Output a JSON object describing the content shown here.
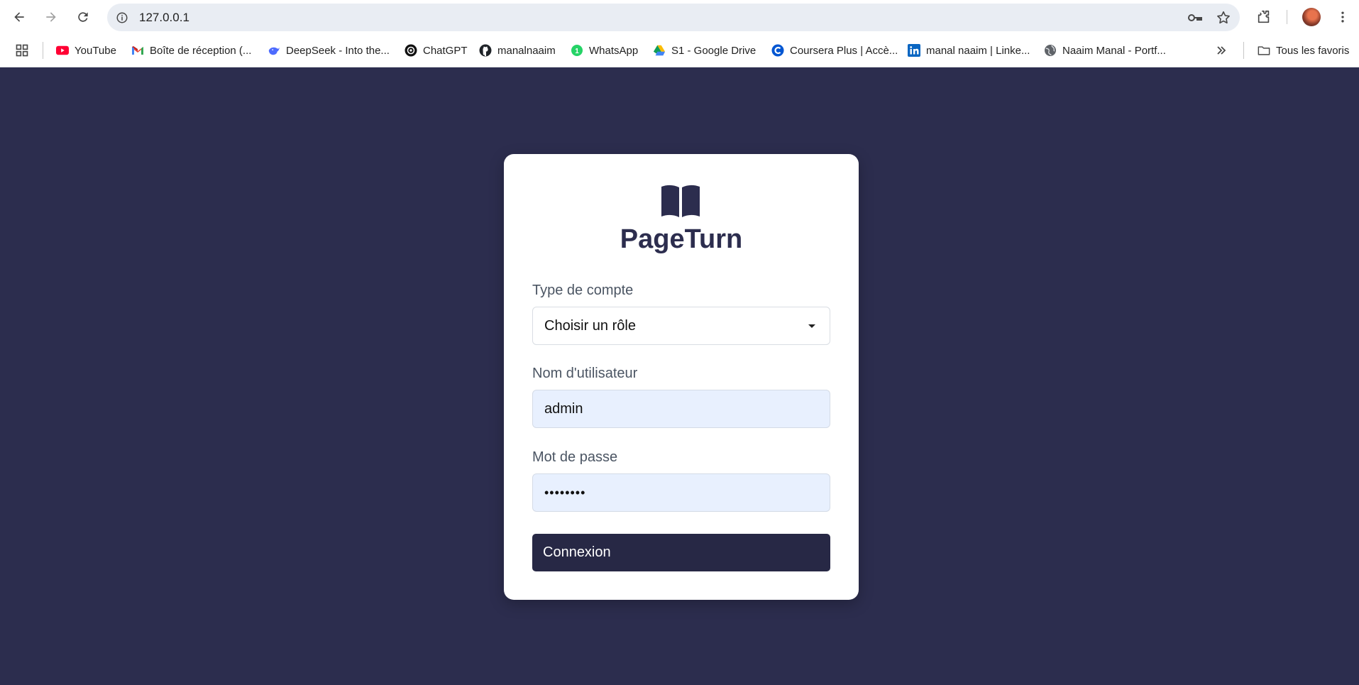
{
  "browser": {
    "url": "127.0.0.1",
    "bookmarks": [
      {
        "label": "YouTube",
        "icon": "youtube-icon"
      },
      {
        "label": "Boîte de réception (...",
        "icon": "gmail-icon"
      },
      {
        "label": "DeepSeek - Into the...",
        "icon": "deepseek-icon"
      },
      {
        "label": "ChatGPT",
        "icon": "chatgpt-icon"
      },
      {
        "label": "manalnaaim",
        "icon": "github-icon"
      },
      {
        "label": "WhatsApp",
        "icon": "whatsapp-icon"
      },
      {
        "label": "S1 - Google Drive",
        "icon": "google-drive-icon"
      },
      {
        "label": "Coursera Plus | Accè...",
        "icon": "coursera-icon"
      },
      {
        "label": "manal naaim | Linke...",
        "icon": "linkedin-icon"
      },
      {
        "label": "Naaim Manal - Portf...",
        "icon": "globe-icon"
      }
    ],
    "all_bookmarks_label": "Tous les favoris"
  },
  "login": {
    "brand": "PageTurn",
    "account_type_label": "Type de compte",
    "account_type_value": "Choisir un rôle",
    "username_label": "Nom d'utilisateur",
    "username_value": "admin",
    "password_label": "Mot de passe",
    "password_value": "••••••••",
    "submit_label": "Connexion"
  },
  "colors": {
    "page_background": "#2c2d4e",
    "brand": "#2c2d4e",
    "button": "#272845",
    "input_fill": "#e8f0fe"
  }
}
